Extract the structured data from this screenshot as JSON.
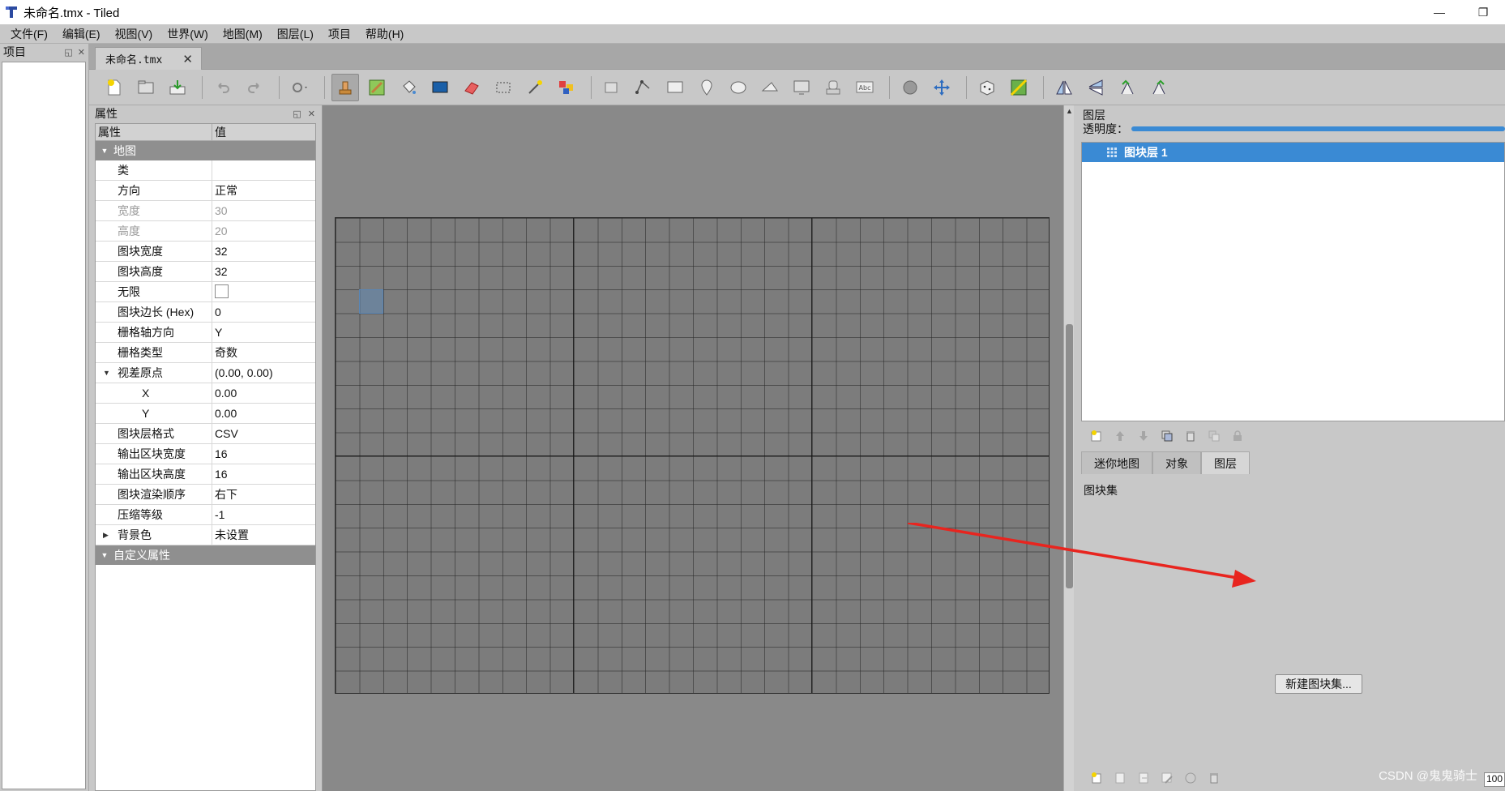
{
  "window": {
    "title": "未命名.tmx - Tiled",
    "minimize_icon": "—",
    "restore_icon": "❐"
  },
  "menu": [
    "文件(F)",
    "编辑(E)",
    "视图(V)",
    "世界(W)",
    "地图(M)",
    "图层(L)",
    "项目",
    "帮助(H)"
  ],
  "project_dock": {
    "title": "项目"
  },
  "document_tab": {
    "label": "未命名.tmx",
    "close": "✕"
  },
  "properties": {
    "title": "属性",
    "col_name": "属性",
    "col_value": "值",
    "group_map": "地图",
    "rows": [
      {
        "name": "类",
        "value": ""
      },
      {
        "name": "方向",
        "value": "正常"
      },
      {
        "name": "宽度",
        "value": "30"
      },
      {
        "name": "高度",
        "value": "20"
      },
      {
        "name": "图块宽度",
        "value": "32"
      },
      {
        "name": "图块高度",
        "value": "32"
      },
      {
        "name": "无限",
        "value": ""
      },
      {
        "name": "图块边长 (Hex)",
        "value": "0"
      },
      {
        "name": "栅格轴方向",
        "value": "Y"
      },
      {
        "name": "栅格类型",
        "value": "奇数"
      },
      {
        "name": "视差原点",
        "value": "(0.00, 0.00)"
      },
      {
        "name": "X",
        "value": "0.00"
      },
      {
        "name": "Y",
        "value": "0.00"
      },
      {
        "name": "图块层格式",
        "value": "CSV"
      },
      {
        "name": "输出区块宽度",
        "value": "16"
      },
      {
        "name": "输出区块高度",
        "value": "16"
      },
      {
        "name": "图块渲染顺序",
        "value": "右下"
      },
      {
        "name": "压缩等级",
        "value": "-1"
      },
      {
        "name": "背景色",
        "value": "未设置"
      }
    ],
    "group_custom": "自定义属性"
  },
  "layers": {
    "title": "图层",
    "opacity_label": "透明度：",
    "opacity_value": 1.0,
    "items": [
      {
        "name": "图块层 1"
      }
    ]
  },
  "right_tabs": [
    "迷你地图",
    "对象",
    "图层"
  ],
  "tilesets": {
    "label": "图块集",
    "new_button": "新建图块集..."
  },
  "zoom_field": "100",
  "watermark": "CSDN @鬼鬼骑士",
  "colors": {
    "accent": "#3a8ad4",
    "arrow": "#e8251f",
    "canvas": "#898989",
    "panel": "#c8c8c8"
  }
}
